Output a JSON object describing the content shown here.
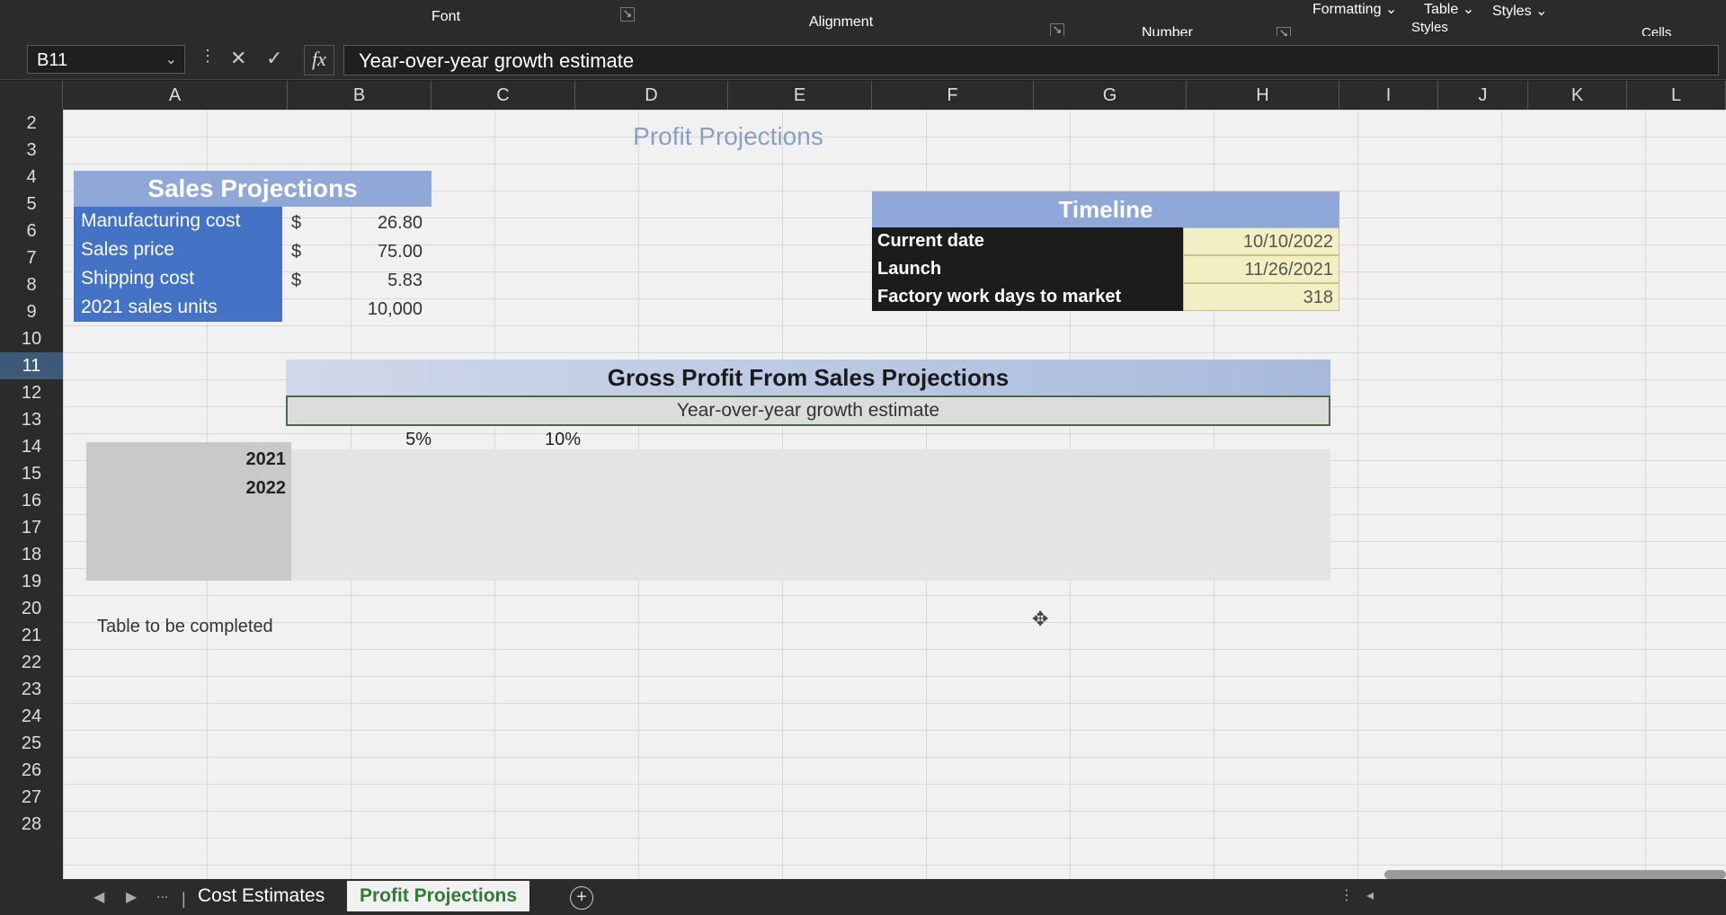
{
  "ribbon": {
    "groups": [
      "Font",
      "Alignment",
      "Number",
      "Styles",
      "Cells"
    ],
    "items": [
      "Formatting",
      "Table",
      "Styles"
    ]
  },
  "formula_bar": {
    "name_box": "B11",
    "formula": "Year-over-year growth estimate"
  },
  "columns": [
    "A",
    "B",
    "C",
    "D",
    "E",
    "F",
    "G",
    "H",
    "I",
    "J",
    "K",
    "L"
  ],
  "rows": [
    "2",
    "3",
    "4",
    "5",
    "6",
    "7",
    "8",
    "9",
    "10",
    "11",
    "12",
    "13",
    "14",
    "15",
    "16",
    "17",
    "18",
    "19",
    "20",
    "21",
    "22",
    "23",
    "24",
    "25",
    "26",
    "27",
    "28"
  ],
  "selected_row": "11",
  "sheet": {
    "title": "Profit Projections",
    "sales": {
      "title": "Sales Projections",
      "items": [
        {
          "label": "Manufacturing cost",
          "currency": "$",
          "value": "26.80"
        },
        {
          "label": "Sales price",
          "currency": "$",
          "value": "75.00"
        },
        {
          "label": "Shipping cost",
          "currency": "$",
          "value": "5.83"
        },
        {
          "label": "2021 sales units",
          "currency": "",
          "value": "10,000"
        }
      ]
    },
    "timeline": {
      "title": "Timeline",
      "items": [
        {
          "label": "Current date",
          "value": "10/10/2022"
        },
        {
          "label": "Launch",
          "value": "11/26/2021"
        },
        {
          "label": "Factory work days to market",
          "value": "318"
        }
      ]
    },
    "gross_profit": {
      "title": "Gross Profit From Sales Projections",
      "subtitle": "Year-over-year growth estimate",
      "rates": [
        "5%",
        "10%"
      ],
      "years": [
        "2021",
        "2022"
      ]
    },
    "note": "Table to be completed"
  },
  "tabs": {
    "ellipsis": "...",
    "sheets": [
      "Cost Estimates",
      "Profit Projections"
    ],
    "active": "Profit Projections"
  }
}
